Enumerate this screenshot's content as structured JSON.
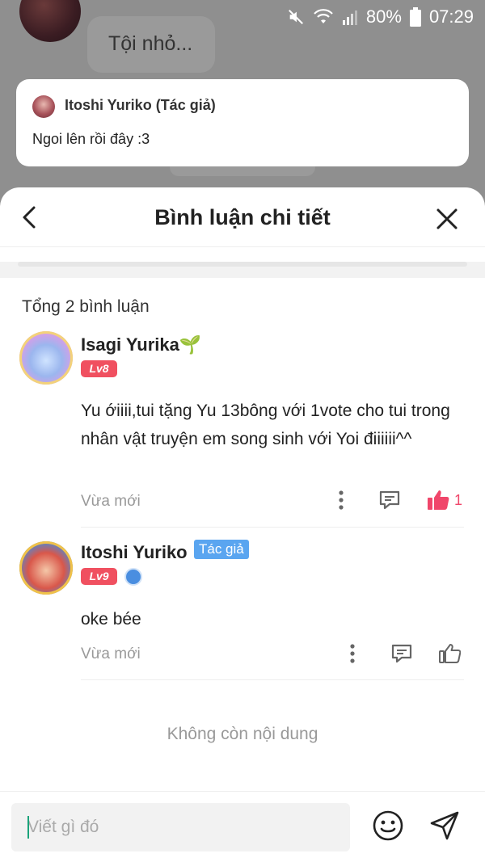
{
  "status_bar": {
    "battery": "80%",
    "time": "07:29"
  },
  "background": {
    "bubble_text": "Tội nhỏ..."
  },
  "preview": {
    "name": "Itoshi Yuriko (Tác giả)",
    "text": "Ngoi lên rồi đây :3"
  },
  "header": {
    "title": "Bình luận chi tiết"
  },
  "summary": {
    "total_label": "Tổng 2 bình luận"
  },
  "comments": [
    {
      "name": "Isagi Yurika🌱",
      "level": "Lv8",
      "text": "Yu ớiiii,tui tặng Yu 13bông với 1vote cho tui trong nhân vật truyện em song sinh với Yoi điiiiii^^",
      "time": "Vừa mới",
      "likes": "1",
      "liked": true
    },
    {
      "name": "Itoshi Yuriko",
      "tag": "Tác giả",
      "level": "Lv9",
      "text": "oke bée",
      "time": "Vừa mới",
      "liked": false
    }
  ],
  "end_text": "Không còn nội dung",
  "composer": {
    "placeholder": "Viết gì đó"
  },
  "colors": {
    "accent_like": "#f0466a",
    "level_badge": "#f05060",
    "author_tag": "#5aa5f0"
  }
}
